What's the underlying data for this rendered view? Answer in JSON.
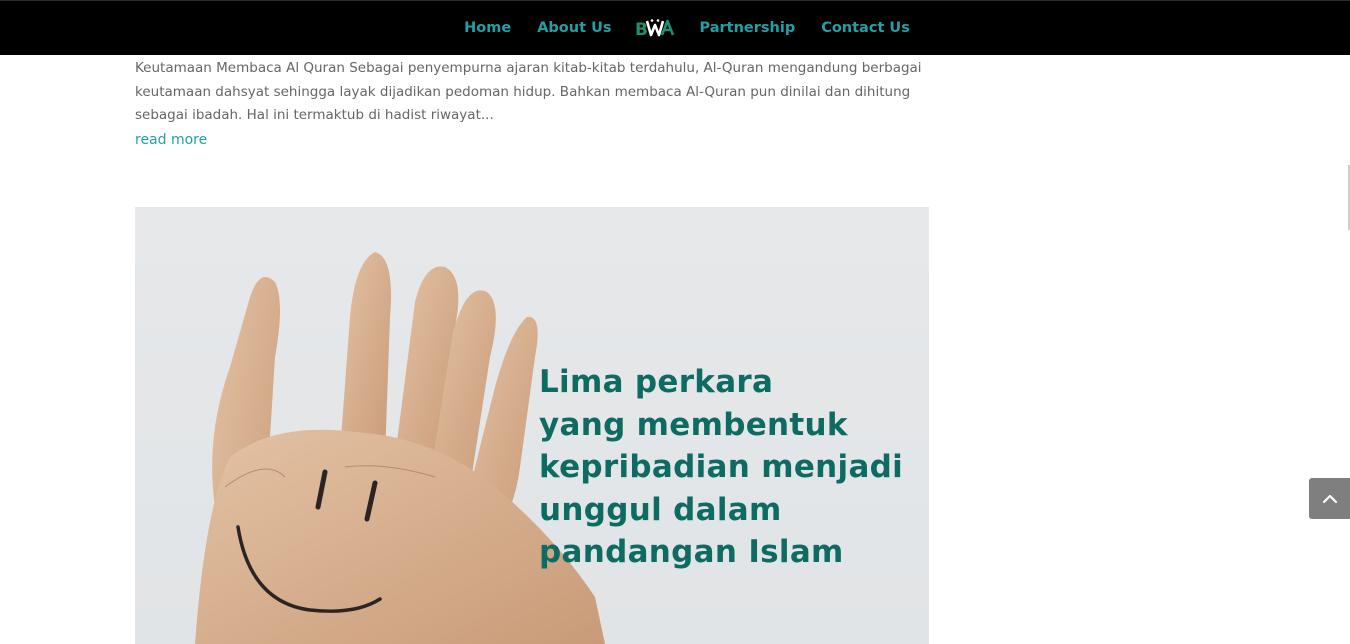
{
  "nav": {
    "items": [
      {
        "label": "Home"
      },
      {
        "label": "About Us"
      },
      {
        "label": "Partnership"
      },
      {
        "label": "Contact Us"
      }
    ],
    "logo_text": "BWA",
    "accent_color": "#23a0a6"
  },
  "post": {
    "excerpt": "Keutamaan Membaca Al Quran    Sebagai penyempurna ajaran kitab-kitab terdahulu, Al-Quran mengandung berbagai keutamaan dahsyat sehingga layak dijadikan pedoman hidup. Bahkan membaca Al-Quran pun dinilai dan dihitung sebagai ibadah. Hal ini termaktub di hadist riwayat...",
    "read_more": "read more"
  },
  "next_post": {
    "image_lines": [
      "Lima perkara",
      "yang membentuk",
      "kepribadian menjadi",
      "unggul dalam",
      "pandangan Islam"
    ],
    "headline_color": "#0e6b62"
  },
  "scroll_top": {
    "icon": "chevron-up-icon"
  }
}
